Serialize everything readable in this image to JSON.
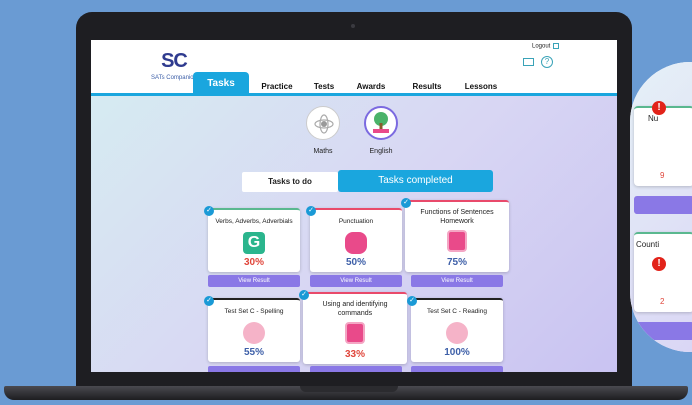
{
  "app": {
    "logo_mark": "SC",
    "logo_text": "SATs Companion",
    "logout_label": "Logout"
  },
  "nav": {
    "tabs": [
      {
        "label": "Tasks",
        "active": true
      },
      {
        "label": "Practice"
      },
      {
        "label": "Tests"
      },
      {
        "label": "Awards"
      },
      {
        "label": "Results"
      },
      {
        "label": "Lessons"
      }
    ]
  },
  "subjects": [
    {
      "label": "Maths",
      "icon": "atom-icon"
    },
    {
      "label": "English",
      "icon": "tree-book-icon",
      "active": true
    }
  ],
  "toggle": {
    "left": "Tasks to do",
    "right": "Tasks completed"
  },
  "cards": [
    {
      "title": "Verbs, Adverbs, Adverbials",
      "percent": "30%",
      "color": "#e0463b",
      "button": "View Result"
    },
    {
      "title": "Punctuation",
      "percent": "50%",
      "color": "#3d5fa8",
      "button": "View Result"
    },
    {
      "title": "Functions of Sentences Homework",
      "percent": "75%",
      "color": "#3d5fa8",
      "button": "View Result"
    },
    {
      "title": "Test Set C - Spelling",
      "percent": "55%",
      "color": "#3d5fa8"
    },
    {
      "title": "Using and identifying commands",
      "percent": "33%",
      "color": "#e0463b"
    },
    {
      "title": "Test Set C - Reading",
      "percent": "100%",
      "color": "#3d5fa8"
    }
  ],
  "zoom": {
    "card1_title": "Nu",
    "card1_pct": "9",
    "card2_title": "Counti",
    "card2_pct": "2"
  },
  "colors": {
    "accent": "#1aa6de",
    "button": "#8a78e6",
    "low": "#e0463b",
    "good": "#3d5fa8"
  }
}
